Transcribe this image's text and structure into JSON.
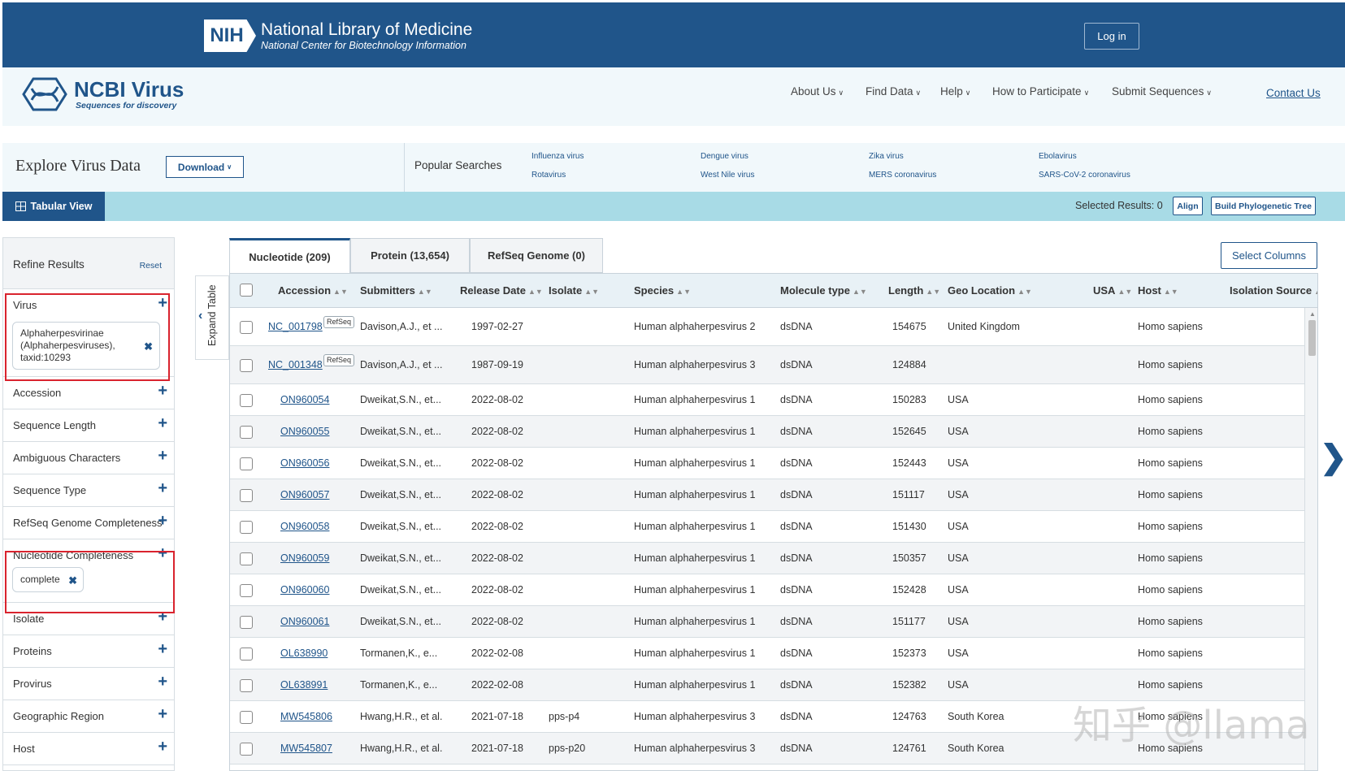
{
  "header": {
    "nih_badge": "NIH",
    "title": "National Library of Medicine",
    "subtitle": "National Center for Biotechnology Information",
    "login": "Log in"
  },
  "brand": {
    "title": "NCBI Virus",
    "tagline": "Sequences for discovery",
    "accent": "#20558a"
  },
  "nav": {
    "items": [
      {
        "label": "About Us"
      },
      {
        "label": "Find Data"
      },
      {
        "label": "Help"
      },
      {
        "label": "How to Participate"
      },
      {
        "label": "Submit Sequences"
      }
    ],
    "contact": "Contact Us"
  },
  "explore": {
    "title": "Explore Virus Data",
    "download": "Download",
    "popular_label": "Popular Searches",
    "popular": [
      "Influenza virus",
      "Dengue virus",
      "Zika virus",
      "Ebolavirus",
      "Rotavirus",
      "West Nile virus",
      "MERS coronavirus",
      "SARS-CoV-2 coronavirus"
    ]
  },
  "toolbar": {
    "tabular_view": "Tabular View",
    "selected_results": "Selected Results: 0",
    "align": "Align",
    "build_tree": "Build Phylogenetic Tree"
  },
  "sidebar": {
    "title": "Refine Results",
    "reset": "Reset",
    "virus_label": "Virus",
    "virus_chip": "Alphaherpesvirinae (Alphaherpesviruses), taxid:10293",
    "nuc_label": "Nucleotide Completeness",
    "nuc_chip": "complete",
    "facets_a": [
      "Accession",
      "Sequence Length",
      "Ambiguous Characters",
      "Sequence Type",
      "RefSeq Genome Completeness"
    ],
    "facets_b": [
      "Isolate",
      "Proteins",
      "Provirus",
      "Geographic Region",
      "Host"
    ]
  },
  "expand": {
    "label": "Expand Table"
  },
  "tabs": [
    {
      "label": "Nucleotide (209)"
    },
    {
      "label": "Protein (13,654)"
    },
    {
      "label": "RefSeq Genome (0)"
    }
  ],
  "select_columns": "Select Columns",
  "table": {
    "columns": [
      "Accession",
      "Submitters",
      "Release Date",
      "Isolate",
      "Species",
      "Molecule type",
      "Length",
      "Geo Location",
      "USA",
      "Host",
      "Isolation Source"
    ],
    "refseq_badge": "RefSeq",
    "rows": [
      {
        "accession": "NC_001798",
        "refseq": true,
        "submitters": "Davison,A.J., et ...",
        "release": "1997-02-27",
        "isolate": "",
        "species": "Human alphaherpesvirus 2",
        "molecule": "dsDNA",
        "length": "154675",
        "geo": "United Kingdom",
        "host": "Homo sapiens"
      },
      {
        "accession": "NC_001348",
        "refseq": true,
        "submitters": "Davison,A.J., et ...",
        "release": "1987-09-19",
        "isolate": "",
        "species": "Human alphaherpesvirus 3",
        "molecule": "dsDNA",
        "length": "124884",
        "geo": "",
        "host": "Homo sapiens"
      },
      {
        "accession": "ON960054",
        "refseq": false,
        "submitters": "Dweikat,S.N., et...",
        "release": "2022-08-02",
        "isolate": "",
        "species": "Human alphaherpesvirus 1",
        "molecule": "dsDNA",
        "length": "150283",
        "geo": "USA",
        "host": "Homo sapiens"
      },
      {
        "accession": "ON960055",
        "refseq": false,
        "submitters": "Dweikat,S.N., et...",
        "release": "2022-08-02",
        "isolate": "",
        "species": "Human alphaherpesvirus 1",
        "molecule": "dsDNA",
        "length": "152645",
        "geo": "USA",
        "host": "Homo sapiens"
      },
      {
        "accession": "ON960056",
        "refseq": false,
        "submitters": "Dweikat,S.N., et...",
        "release": "2022-08-02",
        "isolate": "",
        "species": "Human alphaherpesvirus 1",
        "molecule": "dsDNA",
        "length": "152443",
        "geo": "USA",
        "host": "Homo sapiens"
      },
      {
        "accession": "ON960057",
        "refseq": false,
        "submitters": "Dweikat,S.N., et...",
        "release": "2022-08-02",
        "isolate": "",
        "species": "Human alphaherpesvirus 1",
        "molecule": "dsDNA",
        "length": "151117",
        "geo": "USA",
        "host": "Homo sapiens"
      },
      {
        "accession": "ON960058",
        "refseq": false,
        "submitters": "Dweikat,S.N., et...",
        "release": "2022-08-02",
        "isolate": "",
        "species": "Human alphaherpesvirus 1",
        "molecule": "dsDNA",
        "length": "151430",
        "geo": "USA",
        "host": "Homo sapiens"
      },
      {
        "accession": "ON960059",
        "refseq": false,
        "submitters": "Dweikat,S.N., et...",
        "release": "2022-08-02",
        "isolate": "",
        "species": "Human alphaherpesvirus 1",
        "molecule": "dsDNA",
        "length": "150357",
        "geo": "USA",
        "host": "Homo sapiens"
      },
      {
        "accession": "ON960060",
        "refseq": false,
        "submitters": "Dweikat,S.N., et...",
        "release": "2022-08-02",
        "isolate": "",
        "species": "Human alphaherpesvirus 1",
        "molecule": "dsDNA",
        "length": "152428",
        "geo": "USA",
        "host": "Homo sapiens"
      },
      {
        "accession": "ON960061",
        "refseq": false,
        "submitters": "Dweikat,S.N., et...",
        "release": "2022-08-02",
        "isolate": "",
        "species": "Human alphaherpesvirus 1",
        "molecule": "dsDNA",
        "length": "151177",
        "geo": "USA",
        "host": "Homo sapiens"
      },
      {
        "accession": "OL638990",
        "refseq": false,
        "submitters": "Tormanen,K., e...",
        "release": "2022-02-08",
        "isolate": "",
        "species": "Human alphaherpesvirus 1",
        "molecule": "dsDNA",
        "length": "152373",
        "geo": "USA",
        "host": "Homo sapiens"
      },
      {
        "accession": "OL638991",
        "refseq": false,
        "submitters": "Tormanen,K., e...",
        "release": "2022-02-08",
        "isolate": "",
        "species": "Human alphaherpesvirus 1",
        "molecule": "dsDNA",
        "length": "152382",
        "geo": "USA",
        "host": "Homo sapiens"
      },
      {
        "accession": "MW545806",
        "refseq": false,
        "submitters": "Hwang,H.R., et al.",
        "release": "2021-07-18",
        "isolate": "pps-p4",
        "species": "Human alphaherpesvirus 3",
        "molecule": "dsDNA",
        "length": "124763",
        "geo": "South Korea",
        "host": "Homo sapiens"
      },
      {
        "accession": "MW545807",
        "refseq": false,
        "submitters": "Hwang,H.R., et al.",
        "release": "2021-07-18",
        "isolate": "pps-p20",
        "species": "Human alphaherpesvirus 3",
        "molecule": "dsDNA",
        "length": "124761",
        "geo": "South Korea",
        "host": "Homo sapiens"
      }
    ]
  },
  "watermark": "知乎 @llama"
}
